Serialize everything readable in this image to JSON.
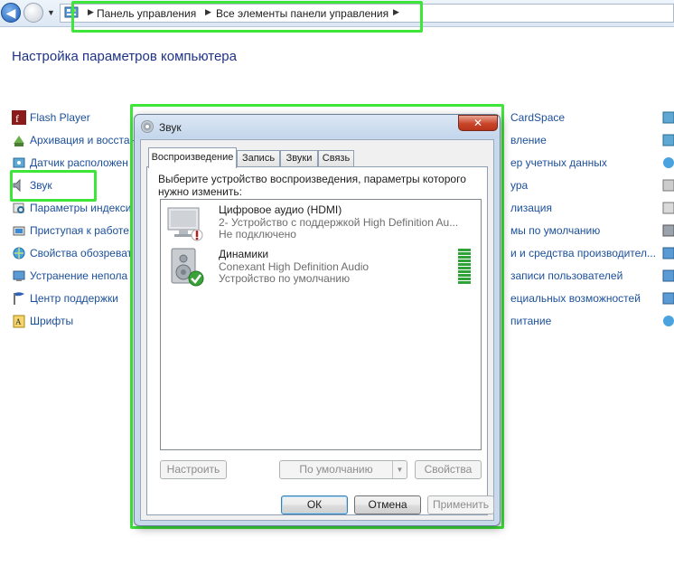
{
  "address_bar": {
    "segments": [
      "Панель управления",
      "Все элементы панели управления"
    ]
  },
  "page": {
    "title": "Настройка параметров компьютера",
    "col1": [
      {
        "label": "Flash Player",
        "icon": "flash-player-icon"
      },
      {
        "label": "Архивация и восстан",
        "icon": "backup-icon"
      },
      {
        "label": "Датчик расположен",
        "icon": "location-sensor-icon"
      },
      {
        "label": "Звук",
        "icon": "speaker-icon"
      },
      {
        "label": "Параметры индекси",
        "icon": "indexing-icon"
      },
      {
        "label": "Приступая к работе",
        "icon": "getting-started-icon"
      },
      {
        "label": "Свойства обозреват",
        "icon": "internet-options-icon"
      },
      {
        "label": "Устранение непола",
        "icon": "troubleshooting-icon"
      },
      {
        "label": "Центр поддержки",
        "icon": "action-center-flag-icon"
      },
      {
        "label": "Шрифты",
        "icon": "fonts-icon"
      }
    ],
    "col3": [
      {
        "label": "CardSpace",
        "icon": "cardspace-icon"
      },
      {
        "label": "вление",
        "icon": "control-icon"
      },
      {
        "label": "ер учетных данных",
        "icon": "credentials-icon"
      },
      {
        "label": "ура",
        "icon": "keyboard-icon"
      },
      {
        "label": "лизация",
        "icon": "personalization-icon"
      },
      {
        "label": "мы по умолчанию",
        "icon": "default-programs-icon"
      },
      {
        "label": "и и средства производител...",
        "icon": "performance-icon"
      },
      {
        "label": "записи пользователей",
        "icon": "user-accounts-icon"
      },
      {
        "label": "ециальных возможностей",
        "icon": "ease-of-access-icon"
      },
      {
        "label": "питание",
        "icon": "power-icon"
      }
    ]
  },
  "dialog": {
    "title": "Звук",
    "close_label": "✕",
    "tabs": [
      "Воспроизведение",
      "Запись",
      "Звуки",
      "Связь"
    ],
    "description": "Выберите устройство воспроизведения, параметры которого нужно изменить:",
    "devices": [
      {
        "name": "Цифровое аудио (HDMI)",
        "subtitle": "2- Устройство с поддержкой High Definition Au...",
        "status": "Не подключено",
        "icon": "hdmi-monitor-icon",
        "badge": "disconnected-badge-icon"
      },
      {
        "name": "Динамики",
        "subtitle": "Conexant High Definition Audio",
        "status": "Устройство по умолчанию",
        "icon": "speakers-device-icon",
        "badge": "default-check-badge-icon"
      }
    ],
    "buttons": {
      "configure": "Настроить",
      "set_default": "По умолчанию",
      "properties": "Свойства",
      "ok": "ОК",
      "cancel": "Отмена",
      "apply": "Применить"
    }
  },
  "colors": {
    "highlight": "#3ee63a",
    "link": "#1b4f9a",
    "title": "#1e3287"
  }
}
